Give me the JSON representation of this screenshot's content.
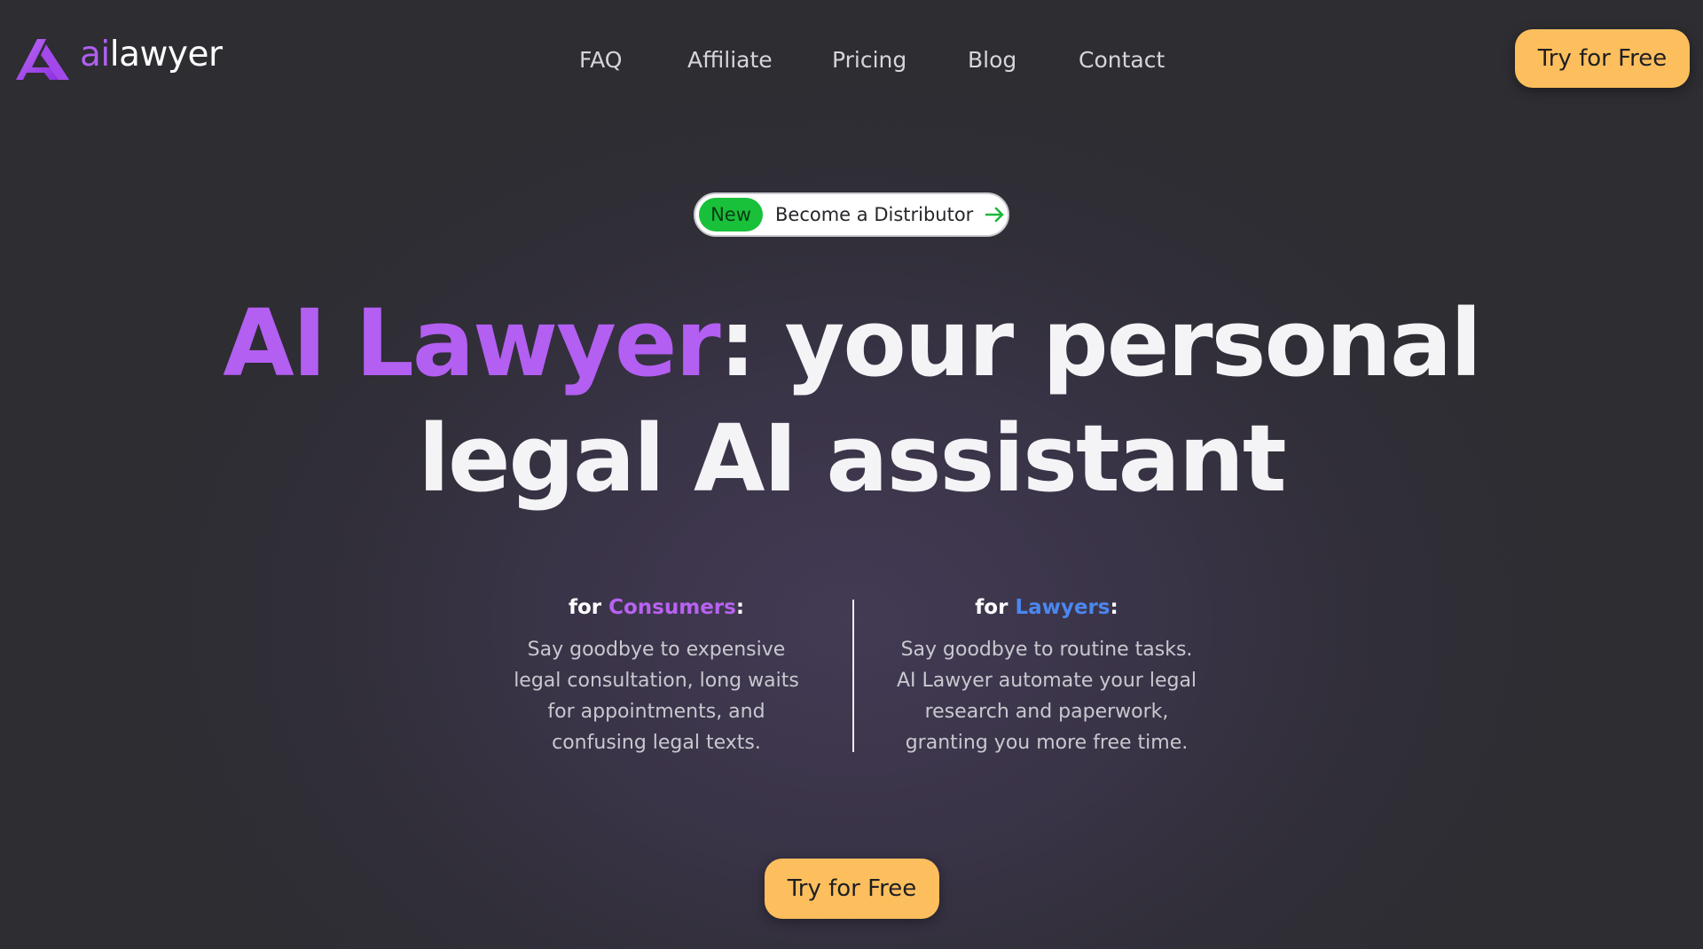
{
  "brand": {
    "logo_ai": "ai",
    "logo_lawyer": "lawyer"
  },
  "nav": {
    "items": [
      {
        "label": "FAQ"
      },
      {
        "label": "Affiliate"
      },
      {
        "label": "Pricing"
      },
      {
        "label": "Blog"
      },
      {
        "label": "Contact"
      }
    ],
    "cta_label": "Try for Free"
  },
  "announcement": {
    "badge": "New",
    "text": "Become a Distributor",
    "icon": "arrow-right-icon"
  },
  "hero": {
    "title_accent": "AI Lawyer",
    "title_rest_line1": ": your personal",
    "title_line2": "legal AI assistant"
  },
  "consumers": {
    "prefix": "for ",
    "highlight": "Consumers",
    "suffix": ":",
    "body": "Say goodbye to expensive legal consultation, long waits for appointments, and confusing legal texts."
  },
  "lawyers": {
    "prefix": "for ",
    "highlight": "Lawyers",
    "suffix": ":",
    "body": "Say goodbye to routine tasks. AI Lawyer automate your legal research and paperwork, granting you more free time."
  },
  "cta_bottom_label": "Try for Free",
  "colors": {
    "accent_purple": "#b35ff2",
    "accent_blue": "#4b87ee",
    "cta_yellow": "#fdbf5d",
    "badge_green": "#19c03a",
    "background": "#2d2d32"
  }
}
